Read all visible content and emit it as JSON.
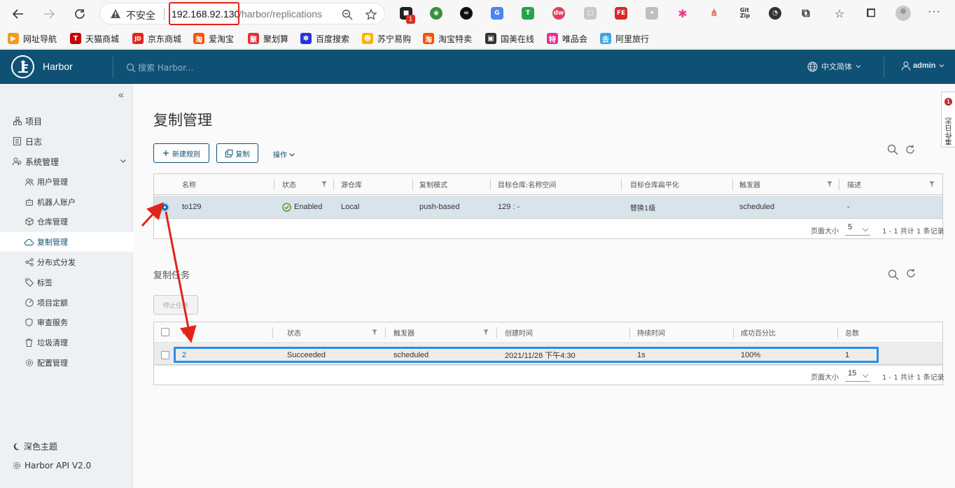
{
  "browser": {
    "security_label": "不安全",
    "url_host": "192.168.92.130",
    "url_path": "/harbor/replications",
    "extension_badge": "1",
    "more": "···",
    "bookmarks": [
      {
        "label": "网址导航",
        "icon": "arrow-bookmark-icon",
        "color": "#f29b1e"
      },
      {
        "label": "天猫商城",
        "icon": "tmall-icon",
        "color": "#c40000",
        "glyph": "T"
      },
      {
        "label": "京东商城",
        "icon": "jd-icon",
        "color": "#e1251b",
        "glyph": "JD"
      },
      {
        "label": "爱淘宝",
        "icon": "taobao-icon",
        "color": "#ff5000",
        "glyph": "淘"
      },
      {
        "label": "聚划算",
        "icon": "juhuasuan-icon",
        "color": "#e72e3a",
        "glyph": "聚"
      },
      {
        "label": "百度搜索",
        "icon": "baidu-paw-icon",
        "color": "#2932e1",
        "glyph": "✽"
      },
      {
        "label": "苏宁易购",
        "icon": "suning-icon",
        "color": "#ffb300",
        "glyph": "☻"
      },
      {
        "label": "淘宝特卖",
        "icon": "taobao-sale-icon",
        "color": "#ff5000",
        "glyph": "淘"
      },
      {
        "label": "国美在线",
        "icon": "gome-icon",
        "color": "#333333",
        "glyph": "▣"
      },
      {
        "label": "唯品会",
        "icon": "vip-icon",
        "color": "#e5328c",
        "glyph": "特"
      },
      {
        "label": "阿里旅行",
        "icon": "alitrip-icon",
        "color": "#3da7e5",
        "glyph": "去"
      }
    ]
  },
  "header": {
    "app_name": "Harbor",
    "search_placeholder": "搜索 Harbor...",
    "language": "中文简体",
    "user": "admin"
  },
  "sidebar": {
    "items": [
      {
        "label": "项目",
        "icon": "project-icon"
      },
      {
        "label": "日志",
        "icon": "log-icon"
      },
      {
        "label": "系统管理",
        "icon": "admin-icon"
      }
    ],
    "sub_items": [
      {
        "label": "用户管理",
        "icon": "users-icon"
      },
      {
        "label": "机器人账户",
        "icon": "robot-icon"
      },
      {
        "label": "仓库管理",
        "icon": "registry-icon"
      },
      {
        "label": "复制管理",
        "icon": "replication-cloud-icon",
        "active": true
      },
      {
        "label": "分布式分发",
        "icon": "share-icon"
      },
      {
        "label": "标签",
        "icon": "tag-icon"
      },
      {
        "label": "项目定额",
        "icon": "quota-icon"
      },
      {
        "label": "审查服务",
        "icon": "shield-icon"
      },
      {
        "label": "垃圾清理",
        "icon": "trash-icon"
      },
      {
        "label": "配置管理",
        "icon": "gear-icon"
      }
    ],
    "theme": "深色主题",
    "api": "Harbor API V2.0"
  },
  "main": {
    "title": "复制管理",
    "new_rule": "新建规则",
    "replicate": "复制",
    "actions": "操作",
    "rules_table": {
      "headers": [
        "名称",
        "状态",
        "源仓库",
        "复制模式",
        "目标仓库:名称空间",
        "目标仓库扁平化",
        "触发器",
        "描述"
      ],
      "rows": [
        {
          "name": "to129",
          "status": "Enabled",
          "source": "Local",
          "mode": "push-based",
          "target": "129 : -",
          "flatten": "替换1级",
          "trigger": "scheduled",
          "desc": "-"
        }
      ],
      "page_size_label": "页面大小",
      "page_size": "5",
      "summary": "1 - 1 共计 1 条记录"
    },
    "tasks_title": "复制任务",
    "stop_task": "停止任务",
    "tasks_table": {
      "headers": [
        "ID",
        "状态",
        "触发器",
        "创建时间",
        "持续时间",
        "成功百分比",
        "总数"
      ],
      "rows": [
        {
          "id": "2",
          "status": "Succeeded",
          "trigger": "scheduled",
          "created": "2021/11/28 下午4:30",
          "duration": "1s",
          "percent": "100%",
          "total": "1"
        }
      ],
      "page_size_label": "页面大小",
      "page_size": "15",
      "summary": "1 - 1 共计 1 条记录"
    }
  },
  "event_log": {
    "label": "事件日志",
    "badge": "1"
  },
  "colors": {
    "header": "#0f5174",
    "accent": "#0072a3",
    "annotation_red": "#e2221b",
    "annotation_blue": "#2b8ee0"
  }
}
